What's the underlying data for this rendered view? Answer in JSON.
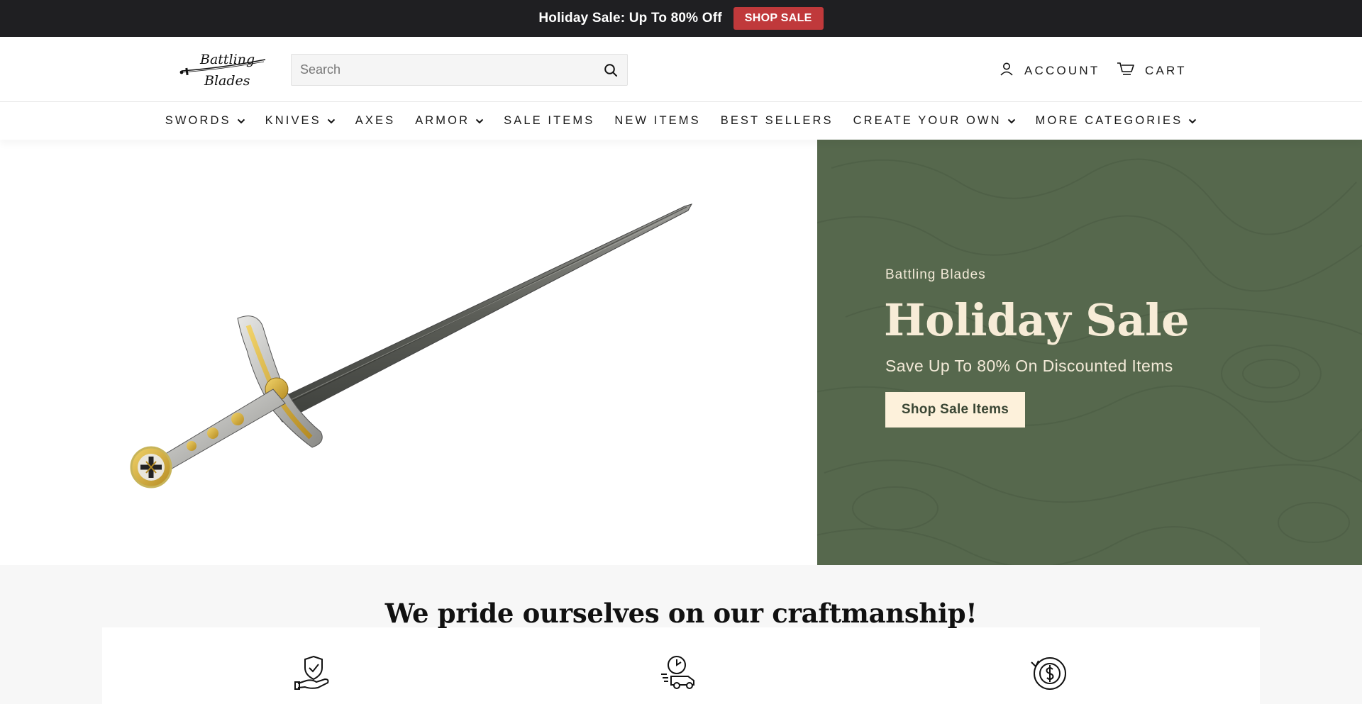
{
  "announcement": {
    "text": "Holiday Sale: Up To 80% Off",
    "button_label": "SHOP SALE",
    "bg_color": "#1f1f22",
    "button_color": "#c0393b"
  },
  "header": {
    "logo_line1": "Battling",
    "logo_line2": "Blades",
    "search_placeholder": "Search",
    "search_value": "",
    "account_label": "ACCOUNT",
    "cart_label": "CART",
    "icons": [
      "search-icon",
      "user-icon",
      "cart-icon"
    ]
  },
  "nav": {
    "items": [
      {
        "label": "SWORDS",
        "has_dropdown": true
      },
      {
        "label": "KNIVES",
        "has_dropdown": true
      },
      {
        "label": "AXES",
        "has_dropdown": false
      },
      {
        "label": "ARMOR",
        "has_dropdown": true
      },
      {
        "label": "SALE ITEMS",
        "has_dropdown": false
      },
      {
        "label": "NEW ITEMS",
        "has_dropdown": false
      },
      {
        "label": "BEST SELLERS",
        "has_dropdown": false
      },
      {
        "label": "CREATE YOUR OWN",
        "has_dropdown": true
      },
      {
        "label": "MORE CATEGORIES",
        "has_dropdown": true
      }
    ]
  },
  "hero": {
    "subtitle": "Battling Blades",
    "title": "Holiday Sale",
    "description": "Save Up To 80% On Discounted Items",
    "button_label": "Shop Sale Items",
    "panel_color": "#56684d",
    "button_color": "#fdf1db",
    "image": "templar-sword-image"
  },
  "craft": {
    "title": "We pride ourselves on our craftmanship!",
    "features": [
      {
        "icon": "shield-hand-icon"
      },
      {
        "icon": "fast-delivery-icon"
      },
      {
        "icon": "money-back-icon"
      }
    ]
  }
}
